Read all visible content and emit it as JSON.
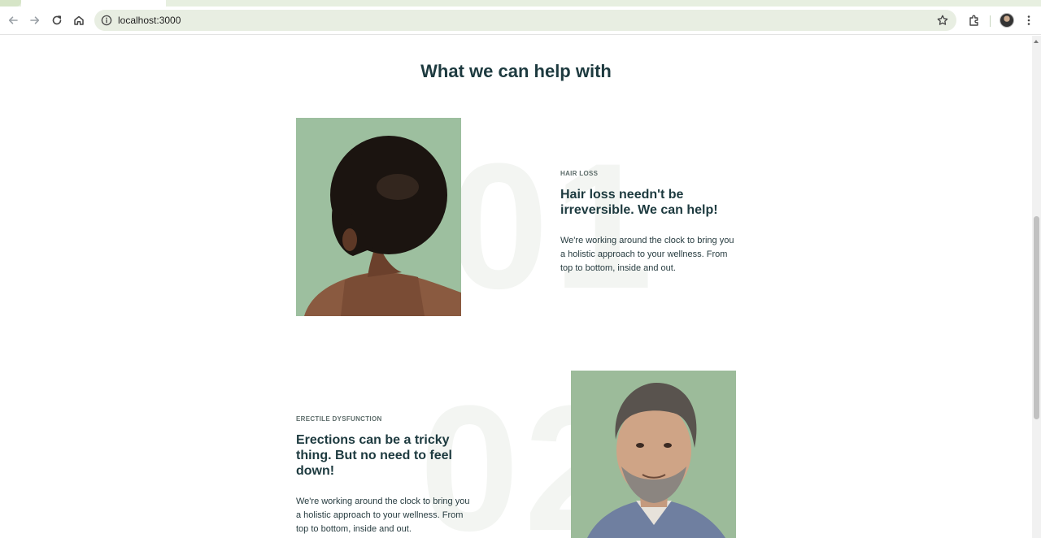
{
  "browser": {
    "url": "localhost:3000",
    "icons": [
      "back-icon",
      "forward-icon",
      "reload-icon",
      "home-icon",
      "site-info-icon",
      "bookmark-star-icon",
      "extensions-icon",
      "profile-avatar",
      "menu-icon"
    ]
  },
  "page": {
    "title": "What we can help with",
    "items": [
      {
        "number": "01",
        "category": "HAIR LOSS",
        "headline": "Hair loss needn't be irreversible. We can help!",
        "body": "We're working around the clock to bring you a holistic approach to your wellness. From top to bottom, inside and out."
      },
      {
        "number": "02",
        "category": "ERECTILE DYSFUNCTION",
        "headline": "Erections can be a tricky thing. But no need to feel down!",
        "body": "We're working around the clock to bring you a holistic approach to your wellness. From top to bottom, inside and out."
      }
    ]
  },
  "colors": {
    "heading": "#1d3a3f",
    "photo_background": "#9dbf9f",
    "omnibox": "#e8eee2",
    "watermark_number": "#f3f5f2"
  }
}
